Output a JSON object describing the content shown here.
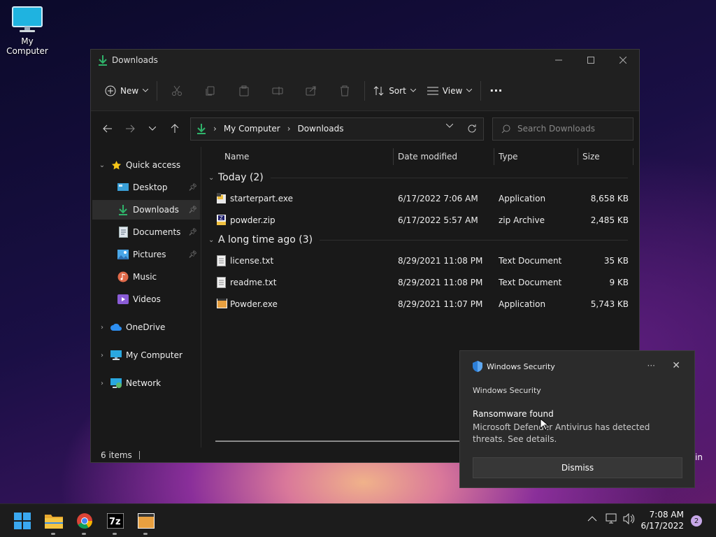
{
  "desktop": {
    "icon_label": "My Computer"
  },
  "window": {
    "title": "Downloads",
    "toolbar": {
      "new_label": "New",
      "sort_label": "Sort",
      "view_label": "View",
      "more": "···"
    },
    "address": {
      "crumbs": [
        "My Computer",
        "Downloads"
      ]
    },
    "search": {
      "placeholder": "Search Downloads"
    },
    "sidebar": {
      "quick_access": "Quick access",
      "items": [
        {
          "label": "Desktop",
          "icon": "desktop-icon",
          "pinned": true
        },
        {
          "label": "Downloads",
          "icon": "download-icon",
          "pinned": true,
          "selected": true
        },
        {
          "label": "Documents",
          "icon": "documents-icon",
          "pinned": true
        },
        {
          "label": "Pictures",
          "icon": "pictures-icon",
          "pinned": true
        },
        {
          "label": "Music",
          "icon": "music-icon",
          "pinned": false
        },
        {
          "label": "Videos",
          "icon": "videos-icon",
          "pinned": false
        }
      ],
      "roots": [
        {
          "label": "OneDrive",
          "icon": "cloud-icon"
        },
        {
          "label": "My Computer",
          "icon": "computer-icon"
        },
        {
          "label": "Network",
          "icon": "network-icon"
        }
      ]
    },
    "columns": {
      "name": "Name",
      "date": "Date modified",
      "type": "Type",
      "size": "Size"
    },
    "groups": [
      {
        "label": "Today (2)",
        "files": [
          {
            "name": "starterpart.exe",
            "date": "6/17/2022 7:06 AM",
            "type": "Application",
            "size": "8,658 KB",
            "icon": "exe-icon"
          },
          {
            "name": "powder.zip",
            "date": "6/17/2022 5:57 AM",
            "type": "zip Archive",
            "size": "2,485 KB",
            "icon": "zip-icon"
          }
        ]
      },
      {
        "label": "A long time ago (3)",
        "files": [
          {
            "name": "license.txt",
            "date": "8/29/2021 11:08 PM",
            "type": "Text Document",
            "size": "35 KB",
            "icon": "text-file-icon"
          },
          {
            "name": "readme.txt",
            "date": "8/29/2021 11:08 PM",
            "type": "Text Document",
            "size": "9 KB",
            "icon": "text-file-icon"
          },
          {
            "name": "Powder.exe",
            "date": "8/29/2021 11:07 PM",
            "type": "Application",
            "size": "5,743 KB",
            "icon": "app-icon"
          }
        ]
      }
    ],
    "status": {
      "items": "6 items"
    }
  },
  "toast": {
    "app": "Windows Security",
    "subtitle": "Windows Security",
    "title": "Ransomware found",
    "message": "Microsoft Defender Antivirus has detected threats. See details.",
    "dismiss": "Dismiss",
    "more": "···"
  },
  "edge_text": "in",
  "taskbar": {
    "time": "7:08 AM",
    "date": "6/17/2022",
    "notifications": "2"
  },
  "colors": {
    "accent": "#0078d4",
    "download_green": "#2fb36a",
    "window_bg": "#191919",
    "taskbar_bg": "#1c1c1c"
  }
}
